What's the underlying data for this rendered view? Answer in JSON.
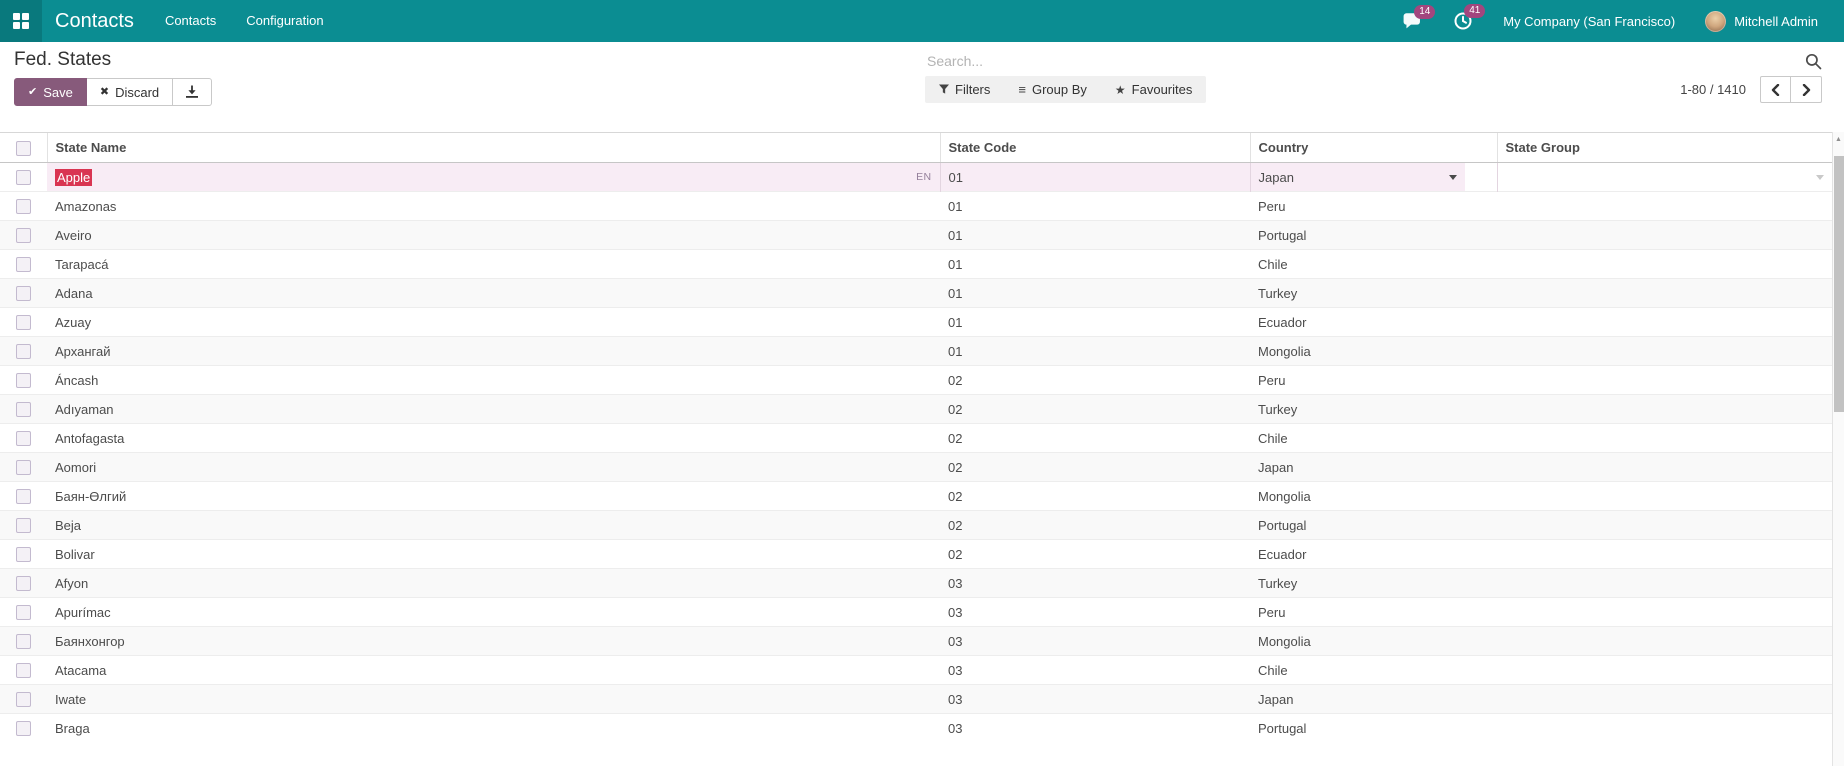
{
  "navbar": {
    "brand": "Contacts",
    "menus": [
      "Contacts",
      "Configuration"
    ],
    "messages_badge": "14",
    "activities_badge": "41",
    "company": "My Company (San Francisco)",
    "user": "Mitchell Admin"
  },
  "control_panel": {
    "title": "Fed. States",
    "save_label": "Save",
    "discard_label": "Discard",
    "search_placeholder": "Search...",
    "filters_label": "Filters",
    "group_by_label": "Group By",
    "favourites_label": "Favourites",
    "pager_text": "1-80 / 1410"
  },
  "icons": {
    "save_check": "✔",
    "discard_x": "✖",
    "group_by_lines": "≡",
    "favourites_star": "★",
    "scroll_up_arrow": "▲"
  },
  "table": {
    "columns": [
      "State Name",
      "State Code",
      "Country",
      "State Group"
    ],
    "edit_row": {
      "state_name": "Apple",
      "translation_badge": "EN",
      "state_code": "01",
      "country": "Japan",
      "state_group": ""
    },
    "rows": [
      {
        "name": "Amazonas",
        "code": "01",
        "country": "Peru"
      },
      {
        "name": "Aveiro",
        "code": "01",
        "country": "Portugal"
      },
      {
        "name": "Tarapacá",
        "code": "01",
        "country": "Chile"
      },
      {
        "name": "Adana",
        "code": "01",
        "country": "Turkey"
      },
      {
        "name": "Azuay",
        "code": "01",
        "country": "Ecuador"
      },
      {
        "name": "Архангай",
        "code": "01",
        "country": "Mongolia"
      },
      {
        "name": "Áncash",
        "code": "02",
        "country": "Peru"
      },
      {
        "name": "Adıyaman",
        "code": "02",
        "country": "Turkey"
      },
      {
        "name": "Antofagasta",
        "code": "02",
        "country": "Chile"
      },
      {
        "name": "Aomori",
        "code": "02",
        "country": "Japan"
      },
      {
        "name": "Баян-Өлгий",
        "code": "02",
        "country": "Mongolia"
      },
      {
        "name": "Beja",
        "code": "02",
        "country": "Portugal"
      },
      {
        "name": "Bolivar",
        "code": "02",
        "country": "Ecuador"
      },
      {
        "name": "Afyon",
        "code": "03",
        "country": "Turkey"
      },
      {
        "name": "Apurímac",
        "code": "03",
        "country": "Peru"
      },
      {
        "name": "Баянхонгор",
        "code": "03",
        "country": "Mongolia"
      },
      {
        "name": "Atacama",
        "code": "03",
        "country": "Chile"
      },
      {
        "name": "Iwate",
        "code": "03",
        "country": "Japan"
      },
      {
        "name": "Braga",
        "code": "03",
        "country": "Portugal"
      }
    ]
  },
  "colors": {
    "navbar_teal": "#0b8d92",
    "badge_purple": "#a2467e",
    "primary_button_purple": "#875A7B",
    "text_selection_red": "#d93552",
    "edit_row_pink": "#f8ecf5"
  }
}
